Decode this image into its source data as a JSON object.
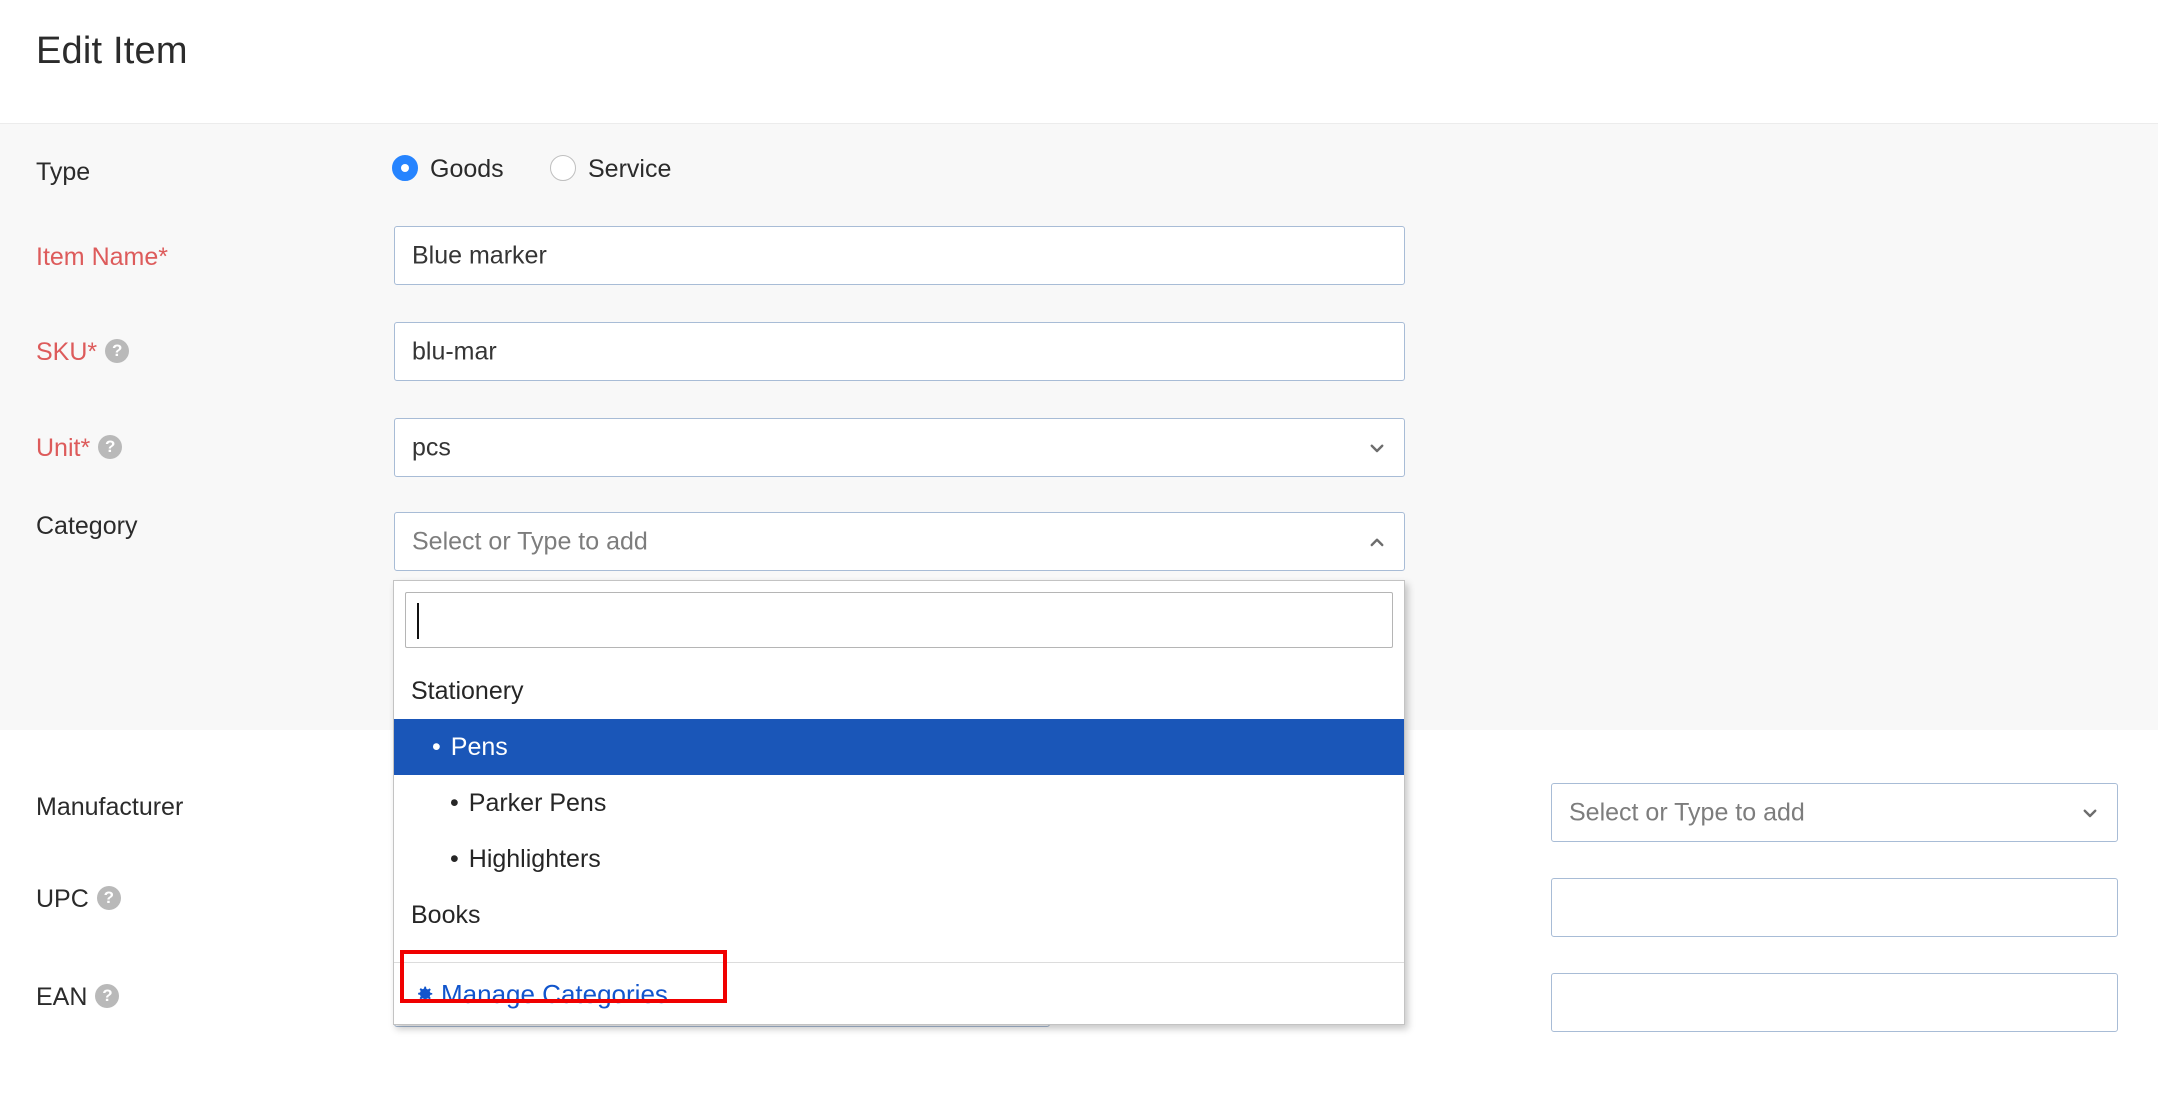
{
  "header": {
    "title": "Edit Item"
  },
  "form": {
    "type": {
      "label": "Type",
      "options": [
        {
          "label": "Goods",
          "selected": true
        },
        {
          "label": "Service",
          "selected": false
        }
      ]
    },
    "item_name": {
      "label": "Item Name*",
      "value": "Blue marker",
      "required": true
    },
    "sku": {
      "label": "SKU*",
      "value": "blu-mar",
      "required": true,
      "help": "?"
    },
    "unit": {
      "label": "Unit*",
      "value": "pcs",
      "required": true,
      "help": "?",
      "chevron": "chevron-down"
    },
    "category": {
      "label": "Category",
      "placeholder": "Select or Type to add",
      "value": "",
      "chevron": "chevron-up",
      "expanded": true
    },
    "manufacturer": {
      "label": "Manufacturer",
      "placeholder": "Select or Type to add",
      "value": "",
      "chevron": "chevron-down"
    },
    "upc": {
      "label": "UPC",
      "value": "",
      "help": "?"
    },
    "ean": {
      "label": "EAN",
      "value": "",
      "help": "?"
    }
  },
  "category_dropdown": {
    "search_value": "",
    "items": [
      {
        "label": "Stationery",
        "level": 0,
        "bullet": false,
        "selected": false
      },
      {
        "label": "Pens",
        "level": 1,
        "bullet": true,
        "selected": true
      },
      {
        "label": "Parker Pens",
        "level": 2,
        "bullet": true,
        "selected": false
      },
      {
        "label": "Highlighters",
        "level": 2,
        "bullet": true,
        "selected": false
      },
      {
        "label": "Books",
        "level": 0,
        "bullet": false,
        "selected": false
      }
    ],
    "bullet_glyph": "•",
    "footer": {
      "label": "Manage Categories",
      "icon": "gear-icon"
    },
    "highlight_color": "#1a56b8",
    "link_color": "#1155cc",
    "annotation_color": "#f00000"
  }
}
